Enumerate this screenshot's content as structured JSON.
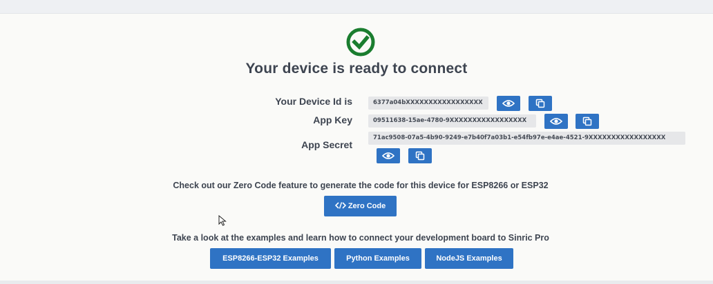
{
  "colors": {
    "primary": "#2f73c4",
    "success": "#1a7d2f",
    "text": "#3d4450"
  },
  "status": {
    "icon": "check-circle-icon",
    "title": "Your device is ready to connect"
  },
  "credentials": {
    "device_id": {
      "label": "Your Device Id is",
      "value": "6377a04bXXXXXXXXXXXXXXXXX"
    },
    "app_key": {
      "label": "App Key",
      "value": "09511638-15ae-4780-9XXXXXXXXXXXXXXXXX"
    },
    "app_secret": {
      "label": "App Secret",
      "value": "71ac9508-07a5-4b90-9249-e7b40f7a03b1-e54fb97e-e4ae-4521-9XXXXXXXXXXXXXXXXX"
    },
    "icons": {
      "reveal": "eye-icon",
      "copy": "copy-icon"
    }
  },
  "zero_code": {
    "text": "Check out our Zero Code feature to generate the code for this device for ESP8266 or ESP32",
    "button_icon": "code-icon",
    "button_label": "Zero Code"
  },
  "examples": {
    "text": "Take a look at the examples and learn how to connect your development board to Sinric Pro",
    "buttons": [
      "ESP8266-ESP32 Examples",
      "Python Examples",
      "NodeJS Examples"
    ]
  }
}
